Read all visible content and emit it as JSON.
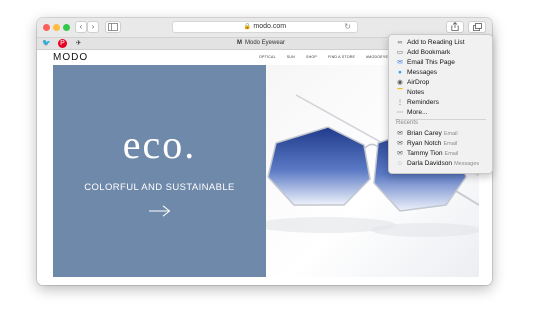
{
  "browser": {
    "url": "modo.com",
    "tab_title": "Modo Eyewear",
    "tab_favicon": "M",
    "back_label": "‹",
    "forward_label": "›"
  },
  "site": {
    "logo": "MODO",
    "nav": [
      "OPTICAL",
      "SUN",
      "SHOP",
      "FIND A STORE",
      "#MODOEYEWEAR"
    ],
    "hero_brand": "eco.",
    "hero_tagline": "COLORFUL AND SUSTAINABLE",
    "hero_bg": "#6f89aa"
  },
  "share_menu": {
    "items": [
      {
        "label": "Add to Reading List",
        "icon": "reading-list-icon",
        "glyph": "∞"
      },
      {
        "label": "Add Bookmark",
        "icon": "bookmark-icon",
        "glyph": "▭"
      },
      {
        "label": "Email This Page",
        "icon": "mail-icon",
        "glyph": "✉"
      },
      {
        "label": "Messages",
        "icon": "messages-icon",
        "glyph": "●"
      },
      {
        "label": "AirDrop",
        "icon": "airdrop-icon",
        "glyph": "◉"
      },
      {
        "label": "Notes",
        "icon": "notes-icon",
        "glyph": "▔"
      },
      {
        "label": "Reminders",
        "icon": "reminders-icon",
        "glyph": "⋮"
      },
      {
        "label": "More...",
        "icon": "more-icon",
        "glyph": "⋯"
      }
    ],
    "recents_heading": "Recents",
    "recents": [
      {
        "name": "Brian Carey",
        "via": "Email"
      },
      {
        "name": "Ryan Notch",
        "via": "Email"
      },
      {
        "name": "Tammy Tion",
        "via": "Email"
      },
      {
        "name": "Darla Davidson",
        "via": "Messages"
      }
    ]
  }
}
